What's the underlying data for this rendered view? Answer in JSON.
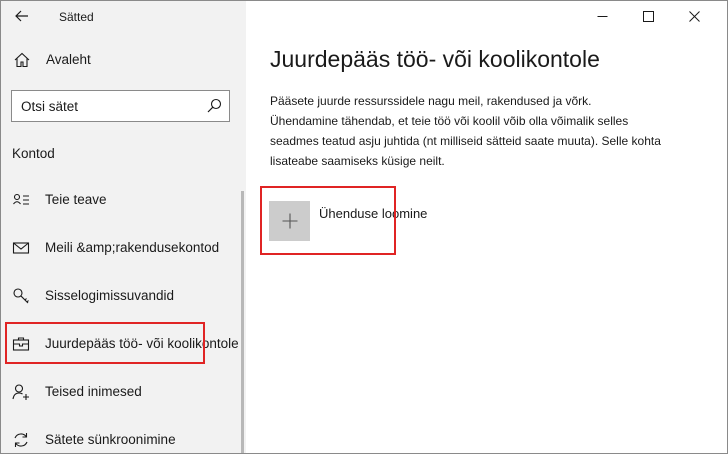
{
  "window": {
    "title": "Sätted",
    "controls": [
      "minimize",
      "maximize",
      "close"
    ]
  },
  "sidebar": {
    "home_label": "Avaleht",
    "search_placeholder": "Otsi sätet",
    "section_label": "Kontod",
    "items": [
      {
        "label": "Teie teave",
        "icon": "person-card-icon"
      },
      {
        "label": "Meili &amp;rakendusekontod",
        "icon": "mail-icon"
      },
      {
        "label": "Sisselogimissuvandid",
        "icon": "key-icon"
      },
      {
        "label": "Juurdepääs töö- või koolikontole",
        "icon": "briefcase-icon",
        "selected": true
      },
      {
        "label": "Teised inimesed",
        "icon": "person-add-icon"
      },
      {
        "label": "Sätete sünkroonimine",
        "icon": "sync-icon"
      }
    ]
  },
  "main": {
    "title": "Juurdepääs töö- või koolikontole",
    "description": [
      "Pääsete juurde ressurssidele nagu meil, rakendused ja võrk.",
      "Ühendamine tähendab, et teie töö või koolil võib olla võimalik selles",
      "seadmes teatud asju juhtida (nt milliseid sätteid saate muuta). Selle kohta",
      "lisateabe saamiseks küsige neilt."
    ],
    "connect_label": "Ühenduse loomine"
  },
  "colors": {
    "sidebar_bg": "#f2f2f2",
    "plus_tile": "#cccccc",
    "highlight": "#e02424"
  }
}
